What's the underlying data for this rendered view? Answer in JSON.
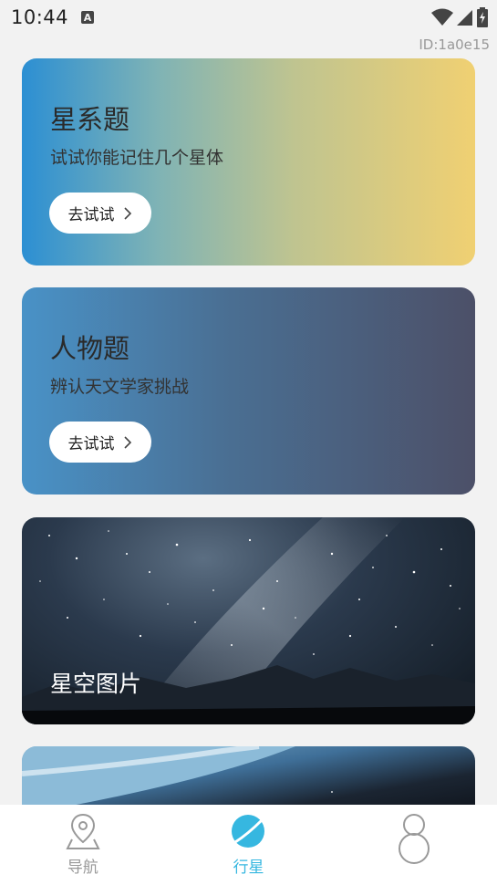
{
  "status_bar": {
    "time": "10:44",
    "notification_badge": "A"
  },
  "debug_id": "ID:1a0e15",
  "cards": [
    {
      "title": "星系题",
      "subtitle": "试试你能记住几个星体",
      "button_label": "去试试"
    },
    {
      "title": "人物题",
      "subtitle": "辨认天文学家挑战",
      "button_label": "去试试"
    },
    {
      "title": "星空图片"
    }
  ],
  "tab_bar": {
    "tabs": [
      {
        "label": "导航",
        "icon": "map-pin-icon",
        "active": false
      },
      {
        "label": "行星",
        "icon": "planet-icon",
        "active": true
      },
      {
        "label": "",
        "icon": "person-icon",
        "active": false
      }
    ],
    "active_color": "#36b7e0",
    "inactive_color": "#999999"
  }
}
